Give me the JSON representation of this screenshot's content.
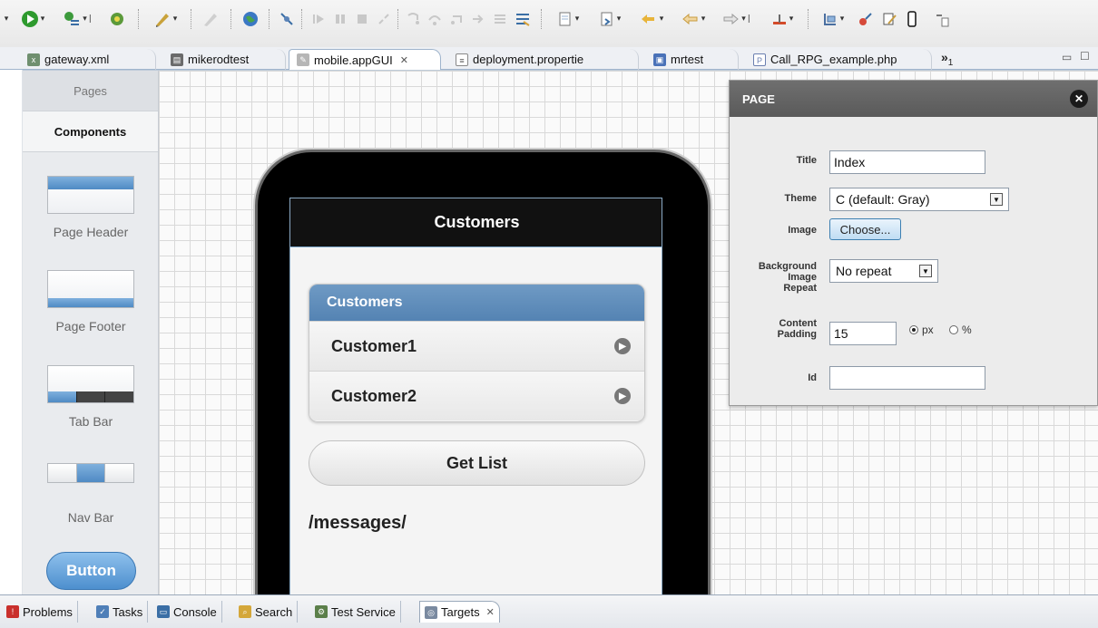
{
  "toolbar": {
    "icons": [
      "run-dropdown-icon",
      "external-tools-icon",
      "debug-icon",
      "pen-tool-icon",
      "web-icon",
      "skip-breakpoints-icon",
      "resume-icon",
      "suspend-icon",
      "terminate-icon",
      "disconnect-icon",
      "step-into-icon",
      "step-over-icon",
      "step-return-icon",
      "drop-to-frame-icon",
      "use-step-filters-icon",
      "new-wizard-icon",
      "next-annotation-icon",
      "previous-annotation-icon",
      "back-icon",
      "forward-icon",
      "pin-icon",
      "window-icon",
      "sync-icon",
      "edit-icon",
      "phone-icon",
      "export-icon"
    ],
    "colors": {
      "run": "#2e9a2e",
      "debug": "#3f7f3f"
    }
  },
  "editor_tabs": [
    {
      "label": "gateway.xml",
      "icon": "xml-file-icon",
      "active": false
    },
    {
      "label": "mikerodtest",
      "icon": "database-icon",
      "active": false
    },
    {
      "label": "mobile.appGUI",
      "icon": "mobile-gui-file-icon",
      "active": true
    },
    {
      "label": "deployment.propertie",
      "icon": "properties-file-icon",
      "active": false
    },
    {
      "label": "mrtest",
      "icon": "server-icon",
      "active": false
    },
    {
      "label": "Call_RPG_example.php",
      "icon": "php-file-icon",
      "active": false
    }
  ],
  "editor_tabs_overflow": {
    "label": "»",
    "count": "1"
  },
  "palette": {
    "tabs": {
      "pages": "Pages",
      "components": "Components"
    },
    "items": [
      {
        "label": "Page Header"
      },
      {
        "label": "Page Footer"
      },
      {
        "label": "Tab Bar"
      },
      {
        "label": "Nav Bar"
      }
    ],
    "button_sample": "Button"
  },
  "phone": {
    "header_title": "Customers",
    "list_divider": "Customers",
    "list_items": [
      "Customer1",
      "Customer2"
    ],
    "button_label": "Get List",
    "messages_text": "/messages/"
  },
  "page_panel": {
    "title": "PAGE",
    "close_icon": "close-icon",
    "fields": {
      "title_label": "Title",
      "title_value": "Index",
      "theme_label": "Theme",
      "theme_value": "C (default: Gray)",
      "image_label": "Image",
      "image_button": "Choose...",
      "bg_label_1": "Background",
      "bg_label_2": "Image",
      "bg_label_3": "Repeat",
      "bg_value": "No repeat",
      "padding_label_1": "Content",
      "padding_label_2": "Padding",
      "padding_value": "15",
      "unit_px": "px",
      "unit_percent": "%",
      "unit_selected": "px",
      "id_label": "Id",
      "id_value": ""
    }
  },
  "views": [
    {
      "label": "Problems",
      "icon": "problems-icon",
      "active": false
    },
    {
      "label": "Tasks",
      "icon": "tasks-icon",
      "active": false
    },
    {
      "label": "Console",
      "icon": "console-icon",
      "active": false
    },
    {
      "label": "Search",
      "icon": "search-icon",
      "active": false
    },
    {
      "label": "Test Service",
      "icon": "test-service-icon",
      "active": false
    },
    {
      "label": "Targets",
      "icon": "targets-icon",
      "active": true
    }
  ],
  "colors": {
    "accent_blue": "#5483b3",
    "panel_header": "#5a5a5a",
    "phone_header": "#111111"
  }
}
